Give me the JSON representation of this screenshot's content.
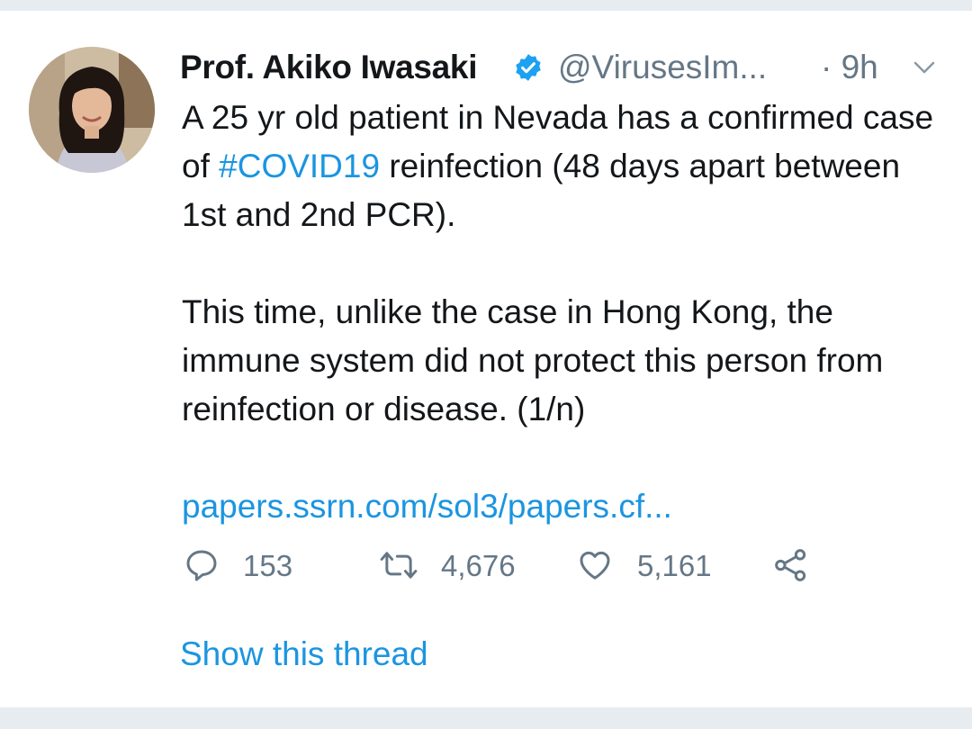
{
  "tweet": {
    "author_name": "Prof. Akiko Iwasaki",
    "handle": "@VirusesIm...",
    "timestamp": "· 9h",
    "text_line_1a": "A 25 yr old patient in Nevada has a confirmed case of ",
    "hashtag": "#COVID19",
    "text_line_1b": " reinfection (48 days apart between 1st and 2nd PCR).",
    "text_para_2": "This time, unlike the case in Hong Kong, the immune system did not protect this person from reinfection or disease. (1/n)",
    "link": "papers.ssrn.com/sol3/papers.cf...",
    "reply_count": "153",
    "retweet_count": "4,676",
    "like_count": "5,161",
    "show_thread_label": "Show this thread"
  },
  "icons": {
    "verified": "verified-badge-icon",
    "chevron": "chevron-down-icon",
    "reply": "reply-icon",
    "retweet": "retweet-icon",
    "like": "heart-icon",
    "share": "share-icon"
  },
  "colors": {
    "accent": "#1b95e0",
    "text": "#14171a",
    "secondary": "#657786",
    "divider": "#e6ecf0"
  }
}
